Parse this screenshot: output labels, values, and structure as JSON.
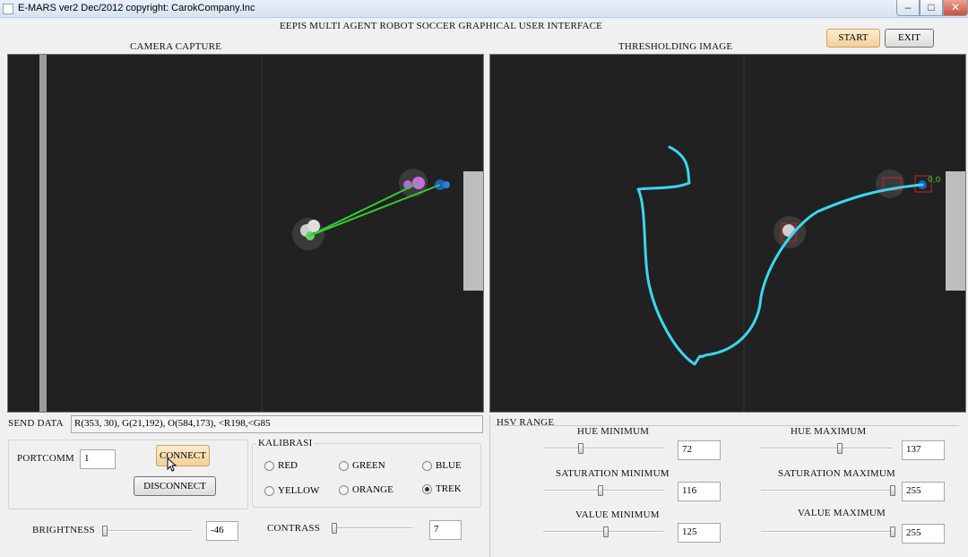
{
  "window": {
    "title": "E-MARS ver2  Dec/2012    copyright: CarokCompany.Inc",
    "min": "‒",
    "max": "□",
    "close": "✕"
  },
  "header": {
    "app_title": "EEPIS MULTI AGENT ROBOT SOCCER   GRAPHICAL USER INTERFACE",
    "start_label": "START",
    "exit_label": "EXIT"
  },
  "camera": {
    "label": "CAMERA CAPTURE"
  },
  "threshold": {
    "label": "THRESHOLDING  IMAGE",
    "marker_text": "0,0"
  },
  "send": {
    "label": "SEND DATA",
    "value": "R(353, 30), G(21,192), O(584,173), <R198,<G85"
  },
  "port": {
    "label": "PORTCOMM",
    "value": "1",
    "connect_label": "CONNECT",
    "disconnect_label": "DISCONNECT"
  },
  "kalibrasi": {
    "title": "KALIBRASI",
    "options": [
      "RED",
      "GREEN",
      "BLUE",
      "YELLOW",
      "ORANGE",
      "TREK"
    ],
    "selected": "TREK"
  },
  "brightness": {
    "label": "BRIGHTNESS",
    "value": "-46",
    "level": 0.02
  },
  "contrass": {
    "label": "CONTRASS",
    "value": "7",
    "level": 0.01
  },
  "hsv": {
    "title": "HSV RANGE",
    "hue_min": {
      "label": "HUE  MINIMUM",
      "value": "72",
      "level": 0.31
    },
    "hue_max": {
      "label": "HUE  MAXIMUM",
      "value": "137",
      "level": 0.6
    },
    "sat_min": {
      "label": "SATURATION  MINIMUM",
      "value": "116",
      "level": 0.48
    },
    "sat_max": {
      "label": "SATURATION  MAXIMUM",
      "value": "255",
      "level": 1.0
    },
    "val_min": {
      "label": "VALUE  MINIMUM",
      "value": "125",
      "level": 0.52
    },
    "val_max": {
      "label": "VALUE MAXIMUM",
      "value": "255",
      "level": 1.0
    }
  },
  "colors": {
    "field": "#212121",
    "trek_line": "#3cd6ee",
    "green_line": "#33cc33",
    "accent": "#f5cf98"
  }
}
